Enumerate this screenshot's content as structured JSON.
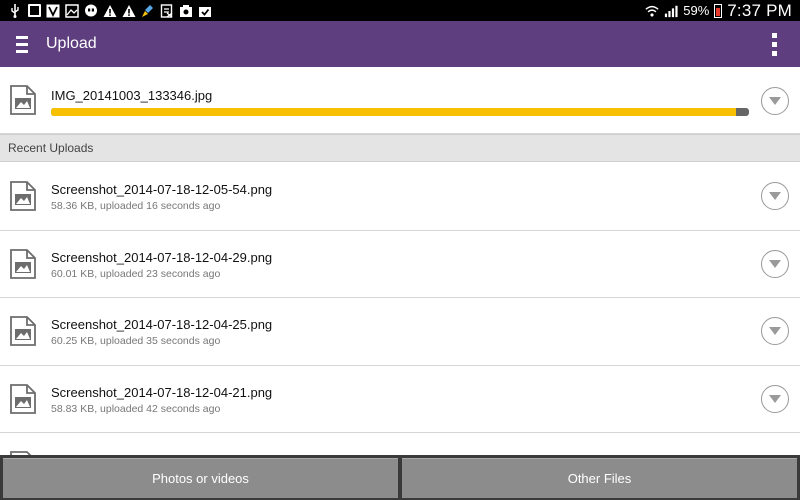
{
  "statusbar": {
    "battery": "59%",
    "time": "7:37 PM",
    "left_icons": [
      "usb-icon",
      "sim-icon",
      "voicemail-icon",
      "image-icon",
      "hangouts-icon",
      "warning-icon",
      "warning-icon",
      "clean-icon",
      "sheet-icon",
      "camera-upload-icon",
      "check-upload-icon"
    ],
    "right_icons": [
      "wifi-icon",
      "signal-icon",
      "battery-icon"
    ]
  },
  "appbar": {
    "title": "Upload"
  },
  "current_upload": {
    "filename": "IMG_20141003_133346.jpg",
    "progress": 0.982,
    "progress_color": "#f7c000"
  },
  "section": {
    "title": "Recent Uploads"
  },
  "recent_uploads": [
    {
      "filename": "Screenshot_2014-07-18-12-05-54.png",
      "meta": "58.36 KB, uploaded 16 seconds ago"
    },
    {
      "filename": "Screenshot_2014-07-18-12-04-29.png",
      "meta": "60.01 KB, uploaded 23 seconds ago"
    },
    {
      "filename": "Screenshot_2014-07-18-12-04-25.png",
      "meta": "60.25 KB, uploaded 35 seconds ago"
    },
    {
      "filename": "Screenshot_2014-07-18-12-04-21.png",
      "meta": "58.83 KB, uploaded 42 seconds ago"
    }
  ],
  "bottom": {
    "photos_label": "Photos or videos",
    "other_label": "Other Files"
  },
  "colors": {
    "appbar": "#5e3e7e",
    "progress": "#f7c000",
    "bottom_button": "#8c8c8c"
  }
}
